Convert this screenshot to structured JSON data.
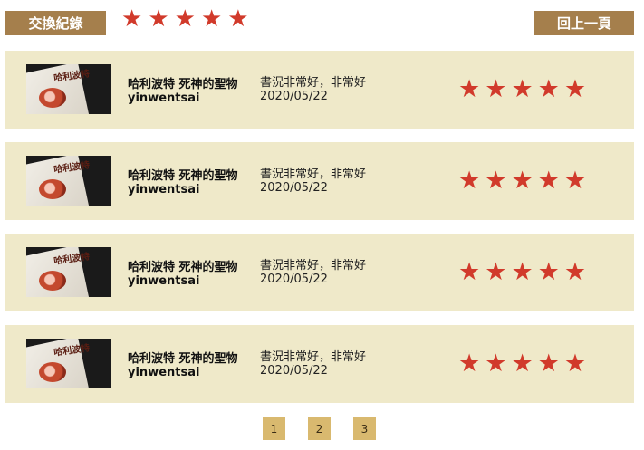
{
  "header": {
    "badge_label": "交換紀錄",
    "back_label": "回上一頁",
    "rating_stars": [
      "★",
      "★",
      "★",
      "★",
      "★"
    ]
  },
  "cover_image": {
    "title_text": "哈利波特",
    "description": "Harry Potter book cover thumbnail"
  },
  "reviews": [
    {
      "book_title": "哈利波特 死神的聖物",
      "reviewer": "yinwentsai",
      "comment": "書況非常好，非常好",
      "date": "2020/05/22",
      "stars": 5
    },
    {
      "book_title": "哈利波特 死神的聖物",
      "reviewer": "yinwentsai",
      "comment": "書況非常好，非常好",
      "date": "2020/05/22",
      "stars": 5
    },
    {
      "book_title": "哈利波特 死神的聖物",
      "reviewer": "yinwentsai",
      "comment": "書況非常好，非常好",
      "date": "2020/05/22",
      "stars": 5
    },
    {
      "book_title": "哈利波特 死神的聖物",
      "reviewer": "yinwentsai",
      "comment": "書況非常好，非常好",
      "date": "2020/05/22",
      "stars": 5
    }
  ],
  "star_glyph": "★",
  "pagination": {
    "pages": [
      "1",
      "2",
      "3"
    ]
  },
  "colors": {
    "accent": "#a57f4c",
    "card_bg": "#efe9c9",
    "star": "#d13a2b",
    "page_button": "#d9b96f"
  }
}
